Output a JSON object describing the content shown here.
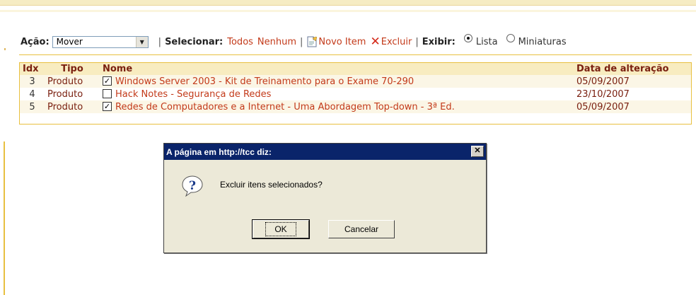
{
  "toolbar": {
    "acao_label": "Ação:",
    "acao_value": "Mover",
    "selecionar_label": "Selecionar:",
    "todos": "Todos",
    "nenhum": "Nenhum",
    "novo_item": "Novo Item",
    "excluir": "Excluir",
    "exibir_label": "Exibir:",
    "lista": "Lista",
    "miniaturas": "Miniaturas",
    "view_selected": "Lista"
  },
  "table": {
    "headers": [
      "Idx",
      "Tipo",
      "Nome",
      "Data de alteração"
    ],
    "rows": [
      {
        "idx": "3",
        "tipo": "Produto",
        "checked": true,
        "nome": "Windows Server 2003 - Kit de Treinamento para o Exame 70-290",
        "data": "05/09/2007"
      },
      {
        "idx": "4",
        "tipo": "Produto",
        "checked": false,
        "nome": "Hack Notes - Segurança de Redes",
        "data": "23/10/2007"
      },
      {
        "idx": "5",
        "tipo": "Produto",
        "checked": true,
        "nome": "Redes de Computadores e a Internet - Uma Abordagem Top-down - 3ª Ed.",
        "data": "05/09/2007"
      }
    ]
  },
  "dialog": {
    "title": "A página em http://tcc diz:",
    "message": "Excluir itens selecionados?",
    "ok": "OK",
    "cancel": "Cancelar"
  },
  "colors": {
    "link": "#c33a1a",
    "header_bg": "#f8ecc0",
    "accent_rule": "#e8c040",
    "titlebar": "#0a246a"
  }
}
